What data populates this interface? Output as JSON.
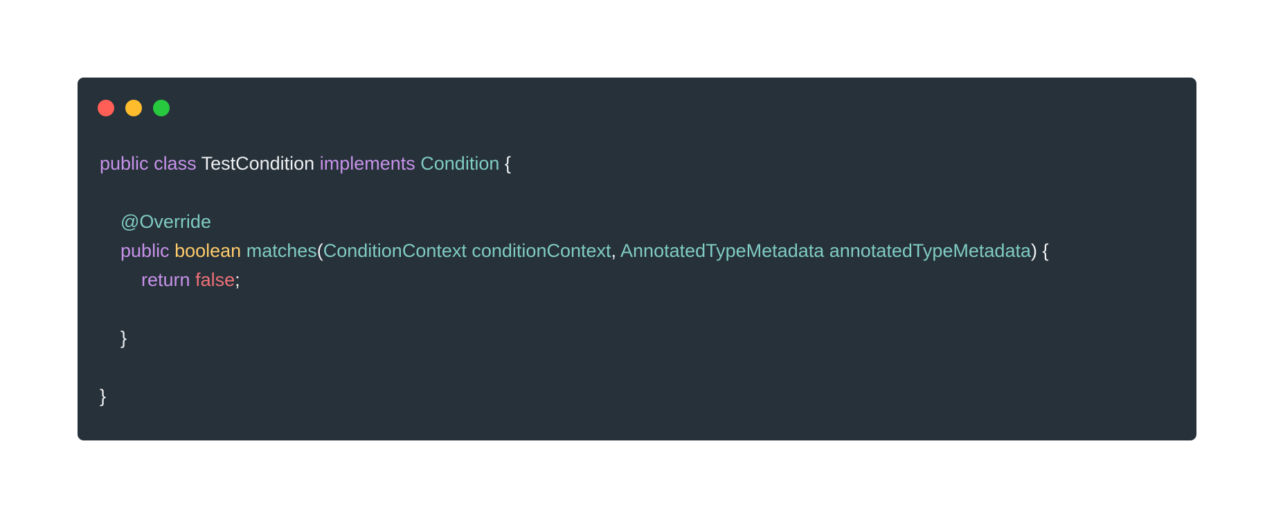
{
  "window": {
    "buttons": [
      {
        "name": "close",
        "color": "#ff5f56"
      },
      {
        "name": "minimize",
        "color": "#ffbd2e"
      },
      {
        "name": "maximize",
        "color": "#27c93f"
      }
    ]
  },
  "theme": {
    "background": "#263139",
    "default": "#eef0f2",
    "keyword": "#c792ea",
    "type": "#80cbc4",
    "primitive": "#ffcb6b",
    "literal": "#f07178"
  },
  "code": {
    "lines": [
      [
        {
          "t": "public",
          "k": "keyword"
        },
        {
          "t": " ",
          "k": "default"
        },
        {
          "t": "class",
          "k": "keyword"
        },
        {
          "t": " ",
          "k": "default"
        },
        {
          "t": "TestCondition",
          "k": "default"
        },
        {
          "t": " ",
          "k": "default"
        },
        {
          "t": "implements",
          "k": "keyword"
        },
        {
          "t": " ",
          "k": "default"
        },
        {
          "t": "Condition",
          "k": "type"
        },
        {
          "t": " {",
          "k": "default"
        }
      ],
      [],
      [
        {
          "t": "    ",
          "k": "default"
        },
        {
          "t": "@Override",
          "k": "type"
        }
      ],
      [
        {
          "t": "    ",
          "k": "default"
        },
        {
          "t": "public",
          "k": "keyword"
        },
        {
          "t": " ",
          "k": "default"
        },
        {
          "t": "boolean",
          "k": "primitive"
        },
        {
          "t": " ",
          "k": "default"
        },
        {
          "t": "matches",
          "k": "type"
        },
        {
          "t": "(",
          "k": "default"
        },
        {
          "t": "ConditionContext conditionContext",
          "k": "type"
        },
        {
          "t": ", ",
          "k": "default"
        },
        {
          "t": "AnnotatedTypeMetadata annotatedTypeMetadata",
          "k": "type"
        },
        {
          "t": ") {",
          "k": "default"
        }
      ],
      [
        {
          "t": "        ",
          "k": "default"
        },
        {
          "t": "return",
          "k": "keyword"
        },
        {
          "t": " ",
          "k": "default"
        },
        {
          "t": "false",
          "k": "literal"
        },
        {
          "t": ";",
          "k": "default"
        }
      ],
      [],
      [
        {
          "t": "    ",
          "k": "default"
        },
        {
          "t": "}",
          "k": "default"
        }
      ],
      [],
      [
        {
          "t": "}",
          "k": "default"
        }
      ]
    ]
  }
}
